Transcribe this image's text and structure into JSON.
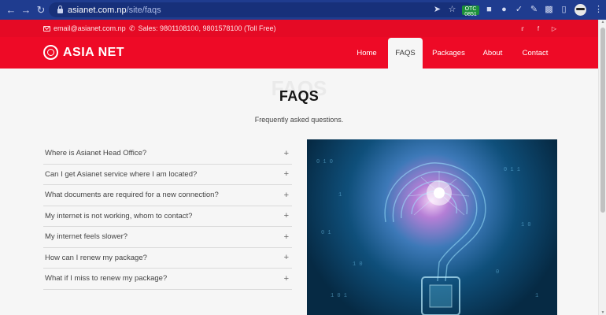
{
  "browser": {
    "url_host": "asianet.com.np",
    "url_path": "/site/faqs",
    "ext_badge": "OTC\n0851"
  },
  "topbar": {
    "email": "email@asianet.com.np",
    "sales": "Sales:  9801108100, 9801578100 (Toll Free)"
  },
  "brand": {
    "name": "ASIA NET"
  },
  "nav": [
    {
      "label": "Home"
    },
    {
      "label": "FAQS"
    },
    {
      "label": "Packages"
    },
    {
      "label": "About"
    },
    {
      "label": "Contact"
    }
  ],
  "page": {
    "ghost_title": "FAQS",
    "title": "FAQS",
    "subtitle": "Frequently asked questions."
  },
  "faqs": [
    {
      "question": "Where is Asianet Head Office?"
    },
    {
      "question": "Can I get Asianet service where I am located?"
    },
    {
      "question": "What documents are required for a new connection?"
    },
    {
      "question": "My internet is not working, whom to contact?"
    },
    {
      "question": "My internet feels slower?"
    },
    {
      "question": "How can I renew my package?"
    },
    {
      "question": "What if I miss to renew my package?"
    }
  ],
  "colors": {
    "brand_red": "#ee0a26",
    "chrome_blue": "#1f3c8f"
  }
}
